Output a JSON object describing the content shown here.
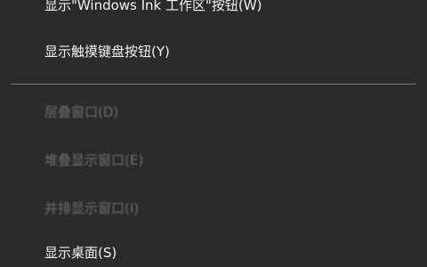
{
  "context_menu": {
    "items": [
      {
        "label": "显示\"Windows Ink 工作区\"按钮(W)",
        "enabled": true
      },
      {
        "label": "显示触摸键盘按钮(Y)",
        "enabled": true
      },
      {
        "label": "层叠窗口(D)",
        "enabled": false
      },
      {
        "label": "堆叠显示窗口(E)",
        "enabled": false
      },
      {
        "label": "并排显示窗口(I)",
        "enabled": false
      },
      {
        "label": "显示桌面(S)",
        "enabled": true
      }
    ]
  }
}
